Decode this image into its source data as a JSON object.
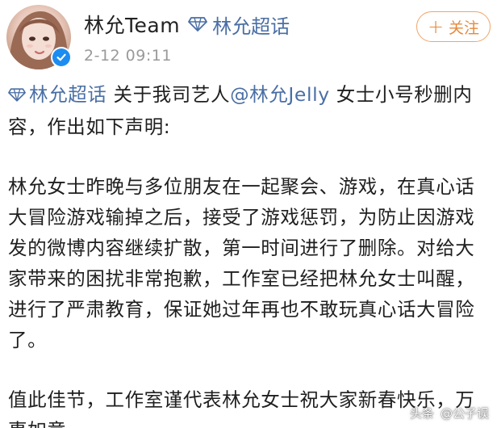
{
  "post": {
    "author_name": "林允Team",
    "supertopic_label": "林允超话",
    "timestamp": "2-12 09:11",
    "follow_label": "关注",
    "follow_icon": "plus-icon",
    "verified_icon": "verified-check-icon",
    "avatar_alt": "avatar",
    "accent_color": "#e58a3c",
    "link_color": "#4a6fa5",
    "verified_color": "#1d8cf0"
  },
  "content": {
    "topic_link": "林允超话",
    "intro_pre": " 关于我司艺人",
    "mention": "@林允Jelly",
    "intro_post": " 女士小号秒删内容，作出如下声明:",
    "paragraph_2": "林允女士昨晚与多位朋友在一起聚会、游戏，在真心话大冒险游戏输掉之后，接受了游戏惩罚，为防止因游戏发的微博内容继续扩散，第一时间进行了删除。对给大家带来的困扰非常抱歉，工作室已经把林允女士叫醒，进行了严肃教育，保证她过年再也不敢玩真心话大冒险了。",
    "paragraph_3": "值此佳节，工作室谨代表林允女士祝大家新春快乐，万事如意。"
  },
  "watermark": {
    "source": "头条",
    "handle": "@公子误"
  }
}
